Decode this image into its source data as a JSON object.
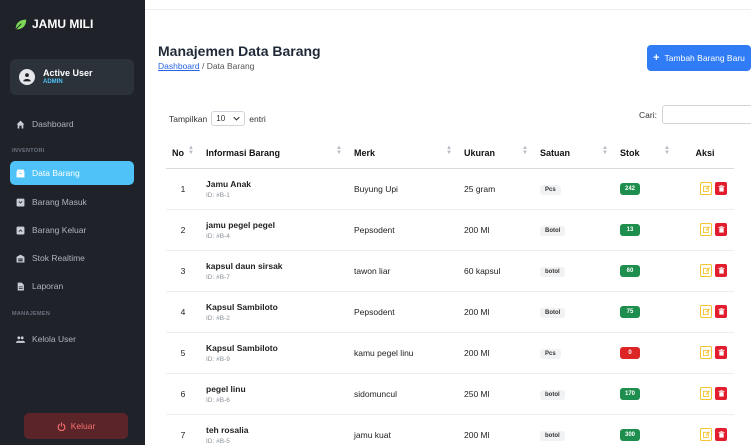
{
  "app": {
    "brand": "JAMU MILI"
  },
  "user": {
    "name": "Active User",
    "role": "ADMIN"
  },
  "sidebar": {
    "sections": {
      "inventory": "INVENTORI",
      "management": "MANAJEMEN"
    },
    "items": [
      {
        "label": "Dashboard",
        "icon": "home-icon"
      },
      {
        "label": "Data Barang",
        "icon": "box-icon"
      },
      {
        "label": "Barang Masuk",
        "icon": "inbox-icon"
      },
      {
        "label": "Barang Keluar",
        "icon": "outbox-icon"
      },
      {
        "label": "Stok Realtime",
        "icon": "warehouse-icon"
      },
      {
        "label": "Laporan",
        "icon": "file-icon"
      },
      {
        "label": "Kelola User",
        "icon": "users-icon"
      }
    ],
    "logout": "Keluar"
  },
  "page": {
    "title": "Manajemen Data Barang",
    "breadcrumb_link": "Dashboard",
    "breadcrumb_sep": " / ",
    "breadcrumb_current": "Data Barang",
    "add_button": "Tambah Barang Baru"
  },
  "table_controls": {
    "show_label": "Tampilkan",
    "show_value": "10",
    "entries_label": "entri",
    "search_label": "Cari:"
  },
  "table": {
    "headers": [
      "No",
      "Informasi Barang",
      "Merk",
      "Ukuran",
      "Satuan",
      "Stok",
      "Aksi"
    ],
    "rows": [
      {
        "no": "1",
        "name": "Jamu Anak",
        "id": "ID: #B-1",
        "merk": "Buyung Upi",
        "ukuran": "25 gram",
        "satuan": "Pcs",
        "stok": "242",
        "stok_color": "#1e8e4e"
      },
      {
        "no": "2",
        "name": "jamu pegel pegel",
        "id": "ID: #B-4",
        "merk": "Pepsodent",
        "ukuran": "200 Ml",
        "satuan": "Botol",
        "stok": "13",
        "stok_color": "#1e8e4e"
      },
      {
        "no": "3",
        "name": "kapsul daun sirsak",
        "id": "ID: #B-7",
        "merk": "tawon liar",
        "ukuran": "60 kapsul",
        "satuan": "botol",
        "stok": "60",
        "stok_color": "#1e8e4e"
      },
      {
        "no": "4",
        "name": "Kapsul Sambiloto",
        "id": "ID: #B-2",
        "merk": "Pepsodent",
        "ukuran": "200 Ml",
        "satuan": "Botol",
        "stok": "75",
        "stok_color": "#1e8e4e"
      },
      {
        "no": "5",
        "name": "Kapsul Sambiloto",
        "id": "ID: #B-9",
        "merk": "kamu pegel linu",
        "ukuran": "200 Ml",
        "satuan": "Pcs",
        "stok": "0",
        "stok_color": "#dc2626"
      },
      {
        "no": "6",
        "name": "pegel linu",
        "id": "ID: #B-6",
        "merk": "sidomuncul",
        "ukuran": "250 Ml",
        "satuan": "botol",
        "stok": "170",
        "stok_color": "#1e8e4e"
      },
      {
        "no": "7",
        "name": "teh rosalia",
        "id": "ID: #B-5",
        "merk": "jamu kuat",
        "ukuran": "200 Ml",
        "satuan": "botol",
        "stok": "300",
        "stok_color": "#1e8e4e"
      }
    ]
  },
  "colors": {
    "sidebar_bg": "#1f2329",
    "accent": "#4fc3f7",
    "primary": "#2f7cf6",
    "danger": "#e11d2e",
    "warning": "#f4c430"
  }
}
